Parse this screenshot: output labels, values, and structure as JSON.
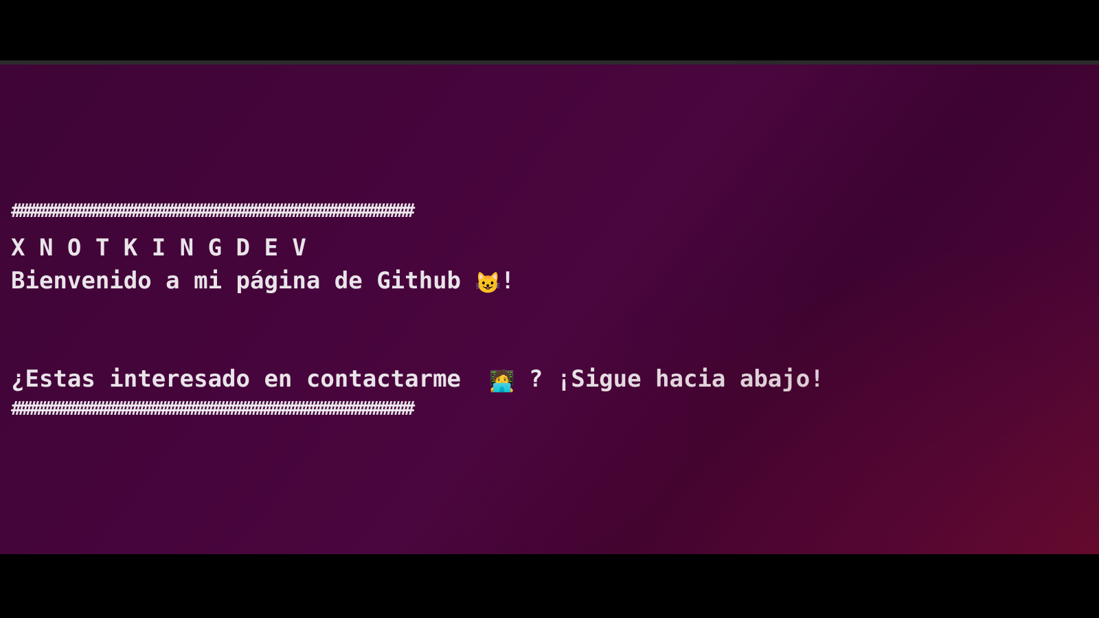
{
  "terminal": {
    "top_border": "#######################################################",
    "title": "X N O T K I N G D E V",
    "welcome_text": "Bienvenido a mi página de Github ",
    "welcome_emoji": "😺",
    "welcome_end": "!",
    "contact_text": "¿Estas interesado en contactarme  ",
    "contact_emoji": "🧑‍💻",
    "contact_end": " ? ¡Sigue hacia abajo!",
    "bottom_border": "#######################################################"
  },
  "icons": {
    "welcome_emoji": "cat-face-icon",
    "contact_emoji": "technologist-icon"
  },
  "colors": {
    "text": "#e9e4e9",
    "background_start": "#3f0536",
    "background_end": "#5a0a30"
  }
}
